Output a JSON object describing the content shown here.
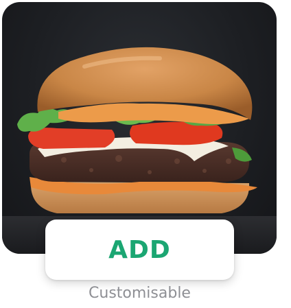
{
  "item": {
    "image_subject": "burger-image",
    "add_button_label": "ADD",
    "customisable_label": "Customisable"
  },
  "colors": {
    "accent_green": "#1ba672",
    "muted_text": "#8e8f94",
    "image_background": "#1d1f23"
  }
}
